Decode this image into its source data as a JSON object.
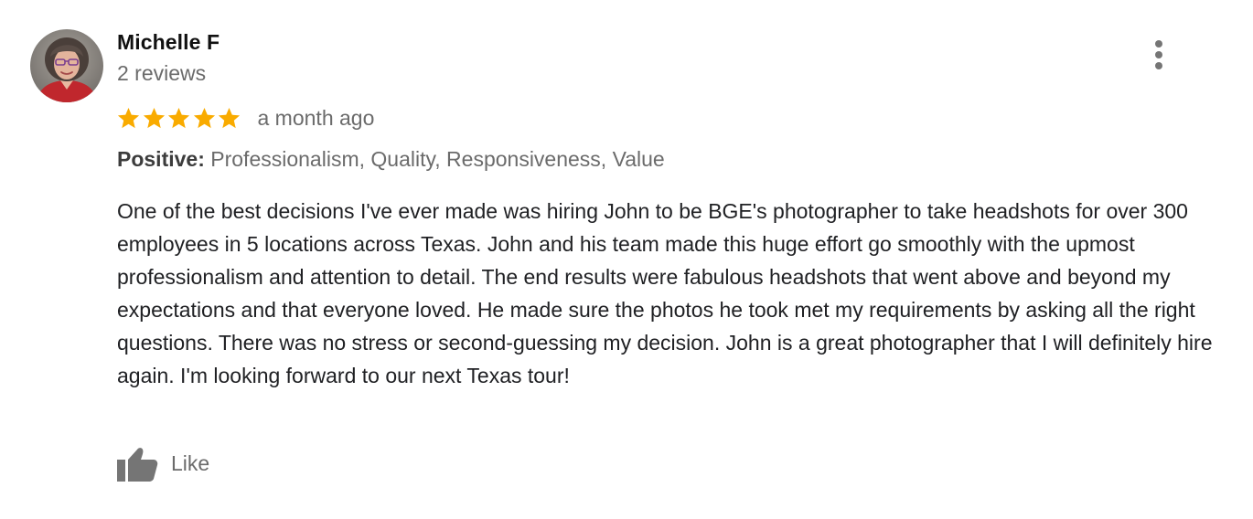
{
  "reviewer": {
    "name": "Michelle F",
    "review_count": "2 reviews",
    "avatar_icon": "user-avatar-photo"
  },
  "menu": {
    "icon": "more-vert-icon"
  },
  "rating": {
    "stars": 5,
    "max_stars": 5,
    "star_color": "#f9ab00",
    "time_ago": "a month ago"
  },
  "aspects": {
    "label": "Positive:",
    "values": "Professionalism, Quality, Responsiveness, Value"
  },
  "review_text": "One of the best decisions I've ever made was hiring John to be BGE's photographer to take headshots for over 300 employees in 5 locations across Texas. John and his team made this huge effort go smoothly with the upmost professionalism and attention to detail. The end results were fabulous headshots that went above and beyond my expectations and that everyone loved. He made sure the photos he took met my requirements by asking all the right questions. There was no stress or second-guessing my decision. John is a great photographer that I will definitely hire again. I'm looking forward to our next Texas tour!",
  "actions": {
    "like_label": "Like",
    "like_icon": "thumbs-up-icon"
  },
  "colors": {
    "name": "#111111",
    "secondary_text": "#6b6b6b",
    "body_text": "#202124",
    "icon": "#757575"
  }
}
